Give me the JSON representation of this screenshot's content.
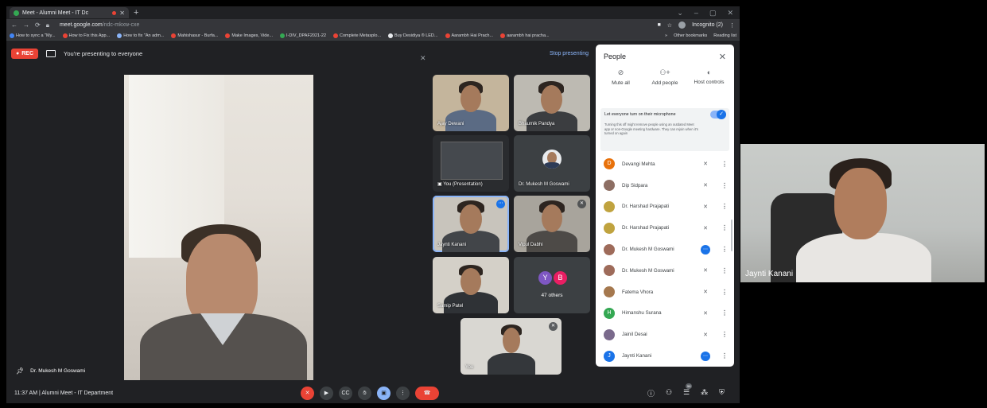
{
  "browser": {
    "tab_title": "Meet - Alumni Meet - IT Dc",
    "new_tab": "+",
    "url_host": "meet.google.com",
    "url_path": "/ndc-mkxw-cxe",
    "incognito": "Incognito (2)",
    "bookmarks": [
      {
        "label": "How to sync a \"My...",
        "color": "#4285f4"
      },
      {
        "label": "How to Fix this App...",
        "color": "#ea4335"
      },
      {
        "label": "How to fix \"An adm...",
        "color": "#8ab4f8"
      },
      {
        "label": "Mahishasur - Burfa...",
        "color": "#ea4335"
      },
      {
        "label": "Make Images, Vide...",
        "color": "#ea4335"
      },
      {
        "label": "I-DIV_DPAF2021-22",
        "color": "#34a853"
      },
      {
        "label": "Complete Metasplo...",
        "color": "#ea4335"
      },
      {
        "label": "Buy Desidiya ® LED...",
        "color": "#e8eaed"
      },
      {
        "label": "Aarambh Hai Prach...",
        "color": "#ea4335"
      },
      {
        "label": "aarambh hai pracha...",
        "color": "#ea4335"
      }
    ],
    "bookmarks_more": "»",
    "other_bookmarks": "Other bookmarks",
    "reading_list": "Reading list"
  },
  "meet": {
    "rec_label": "REC",
    "presenting_text": "You're presenting to everyone",
    "stop_presenting": "Stop presenting",
    "main_speaker": "Dr. Mukesh M Goswami",
    "tiles": [
      {
        "name": "Ajay Dewani"
      },
      {
        "name": "Bhaumik Pandya"
      },
      {
        "name": "You (Presentation)"
      },
      {
        "name": "Dr. Mukesh M Goswami"
      },
      {
        "name": "Jaynti Kanani"
      },
      {
        "name": "Vipul Dabhi"
      },
      {
        "name": "Samip Patel"
      },
      {
        "name": "47 others",
        "avatars": [
          "Y",
          "B"
        ]
      },
      {
        "name": "You"
      }
    ],
    "meeting_info": "11:37 AM  |  Alumni Meet - IT Department",
    "participant_badge": "56"
  },
  "people": {
    "title": "People",
    "actions": [
      "Mute all",
      "Add people",
      "Host controls"
    ],
    "mic_toggle_title": "Let everyone turn on their microphone",
    "mic_toggle_desc": "Turning this off might remove people using an outdated Meet app or non-Google meeting hardware. They can rejoin when it's turned on again",
    "list": [
      {
        "name": "Devangi Mehta",
        "initial": "D",
        "color": "#e8710a",
        "mic": "off"
      },
      {
        "name": "Dip Sidpara",
        "initial": "",
        "color": "#8d6e63",
        "mic": "off"
      },
      {
        "name": "Dr. Harshad Prajapati",
        "initial": "",
        "color": "#c0a33f",
        "mic": "off"
      },
      {
        "name": "Dr. Harshad Prajapati",
        "initial": "",
        "color": "#c0a33f",
        "mic": "off"
      },
      {
        "name": "Dr. Mukesh M Goswami",
        "initial": "",
        "color": "#9e6b5a",
        "mic": "on"
      },
      {
        "name": "Dr. Mukesh M Goswami",
        "initial": "",
        "color": "#9e6b5a",
        "mic": "off"
      },
      {
        "name": "Fatema Vhora",
        "initial": "",
        "color": "#a5784e",
        "mic": "off"
      },
      {
        "name": "Himanshu Surana",
        "initial": "H",
        "color": "#34a853",
        "mic": "off"
      },
      {
        "name": "Jainil Desai",
        "initial": "",
        "color": "#7a6a8c",
        "mic": "off"
      },
      {
        "name": "Jaynti Kanani",
        "initial": "J",
        "color": "#1a73e8",
        "mic": "on"
      }
    ]
  },
  "side_video": {
    "name": "Jaynti Kanani"
  },
  "colors": {
    "accent": "#1a73e8",
    "record": "#ea4335",
    "meet_bg": "#202124"
  }
}
